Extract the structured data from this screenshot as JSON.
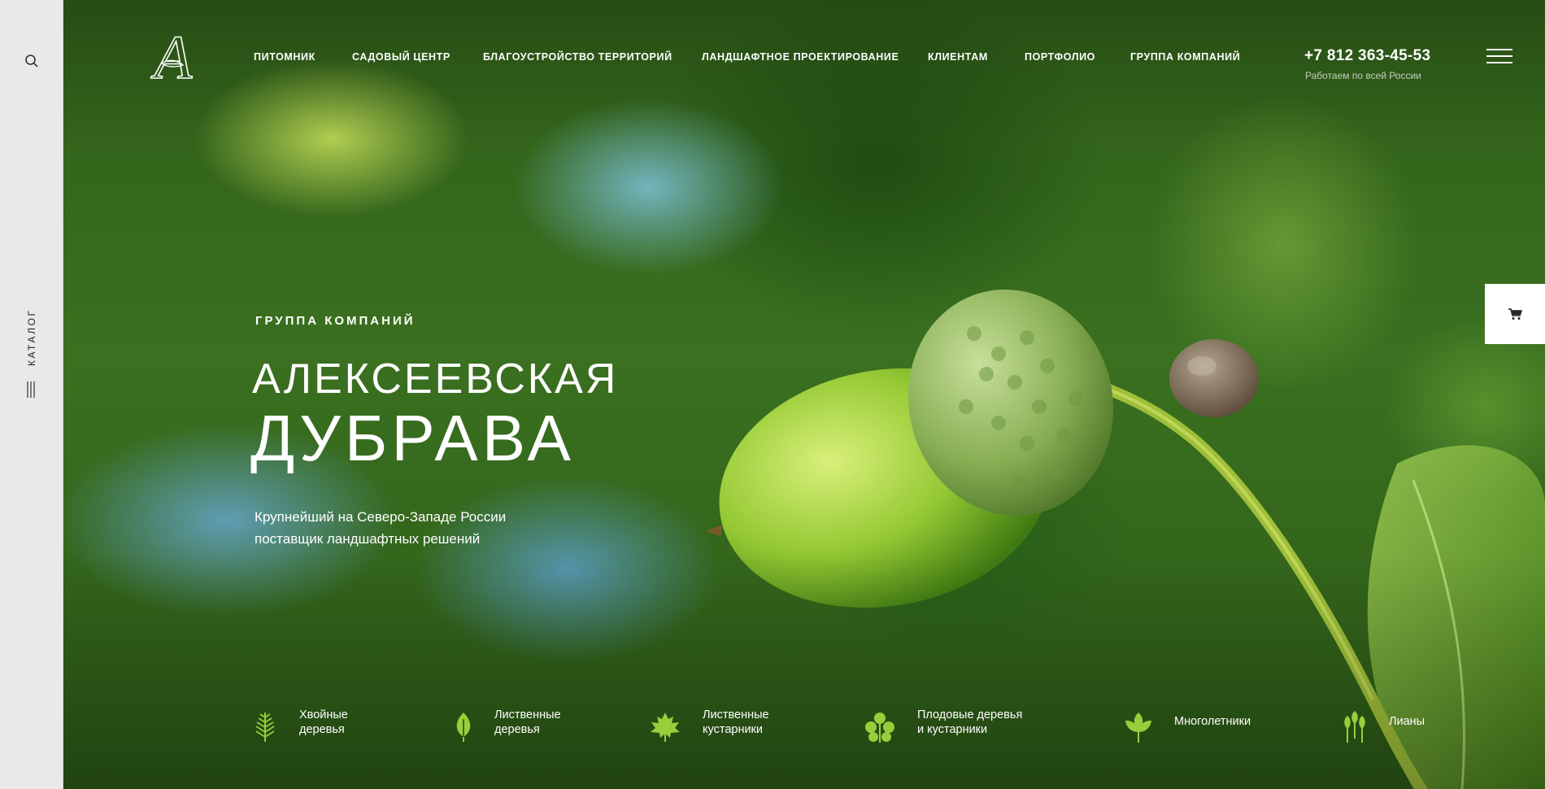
{
  "logo": {
    "letter": "A"
  },
  "sidebar": {
    "catalog_label": "КАТАЛОГ"
  },
  "nav": [
    {
      "label": "ПИТОМНИК"
    },
    {
      "label": "САДОВЫЙ ЦЕНТР"
    },
    {
      "label": "БЛАГОУСТРОЙСТВО ТЕРРИТОРИЙ"
    },
    {
      "label": "ЛАНДШАФТНОЕ ПРОЕКТИРОВАНИЕ"
    },
    {
      "label": "КЛИЕНТАМ"
    },
    {
      "label": "ПОРТФОЛИО"
    },
    {
      "label": "ГРУППА КОМПАНИЙ"
    }
  ],
  "contact": {
    "phone": "+7 812 363-45-53",
    "note": "Работаем по всей России"
  },
  "hero": {
    "eyebrow": "ГРУППА КОМПАНИЙ",
    "title_line1": "АЛЕКСЕЕВСКАЯ",
    "title_line2": "ДУБРАВА",
    "subtitle_line1": "Крупнейший на Северо-Западе России",
    "subtitle_line2": "поставщик ландшафтных решений"
  },
  "categories": [
    {
      "line1": "Хвойные",
      "line2": "деревья",
      "icon": "conifer-icon"
    },
    {
      "line1": "Лиственные",
      "line2": "деревья",
      "icon": "deciduous-tree-icon"
    },
    {
      "line1": "Лиственные",
      "line2": "кустарники",
      "icon": "maple-leaf-icon"
    },
    {
      "line1": "Плодовые деревья",
      "line2": "и кустарники",
      "icon": "fruit-tree-icon"
    },
    {
      "line1": "Многолетники",
      "line2": "",
      "icon": "perennial-icon"
    },
    {
      "line1": "Лианы",
      "line2": "",
      "icon": "vine-icon"
    }
  ],
  "colors": {
    "icon_green": "#9acd3a",
    "sidebar_bg": "#e9e9e9",
    "text": "#ffffff"
  }
}
